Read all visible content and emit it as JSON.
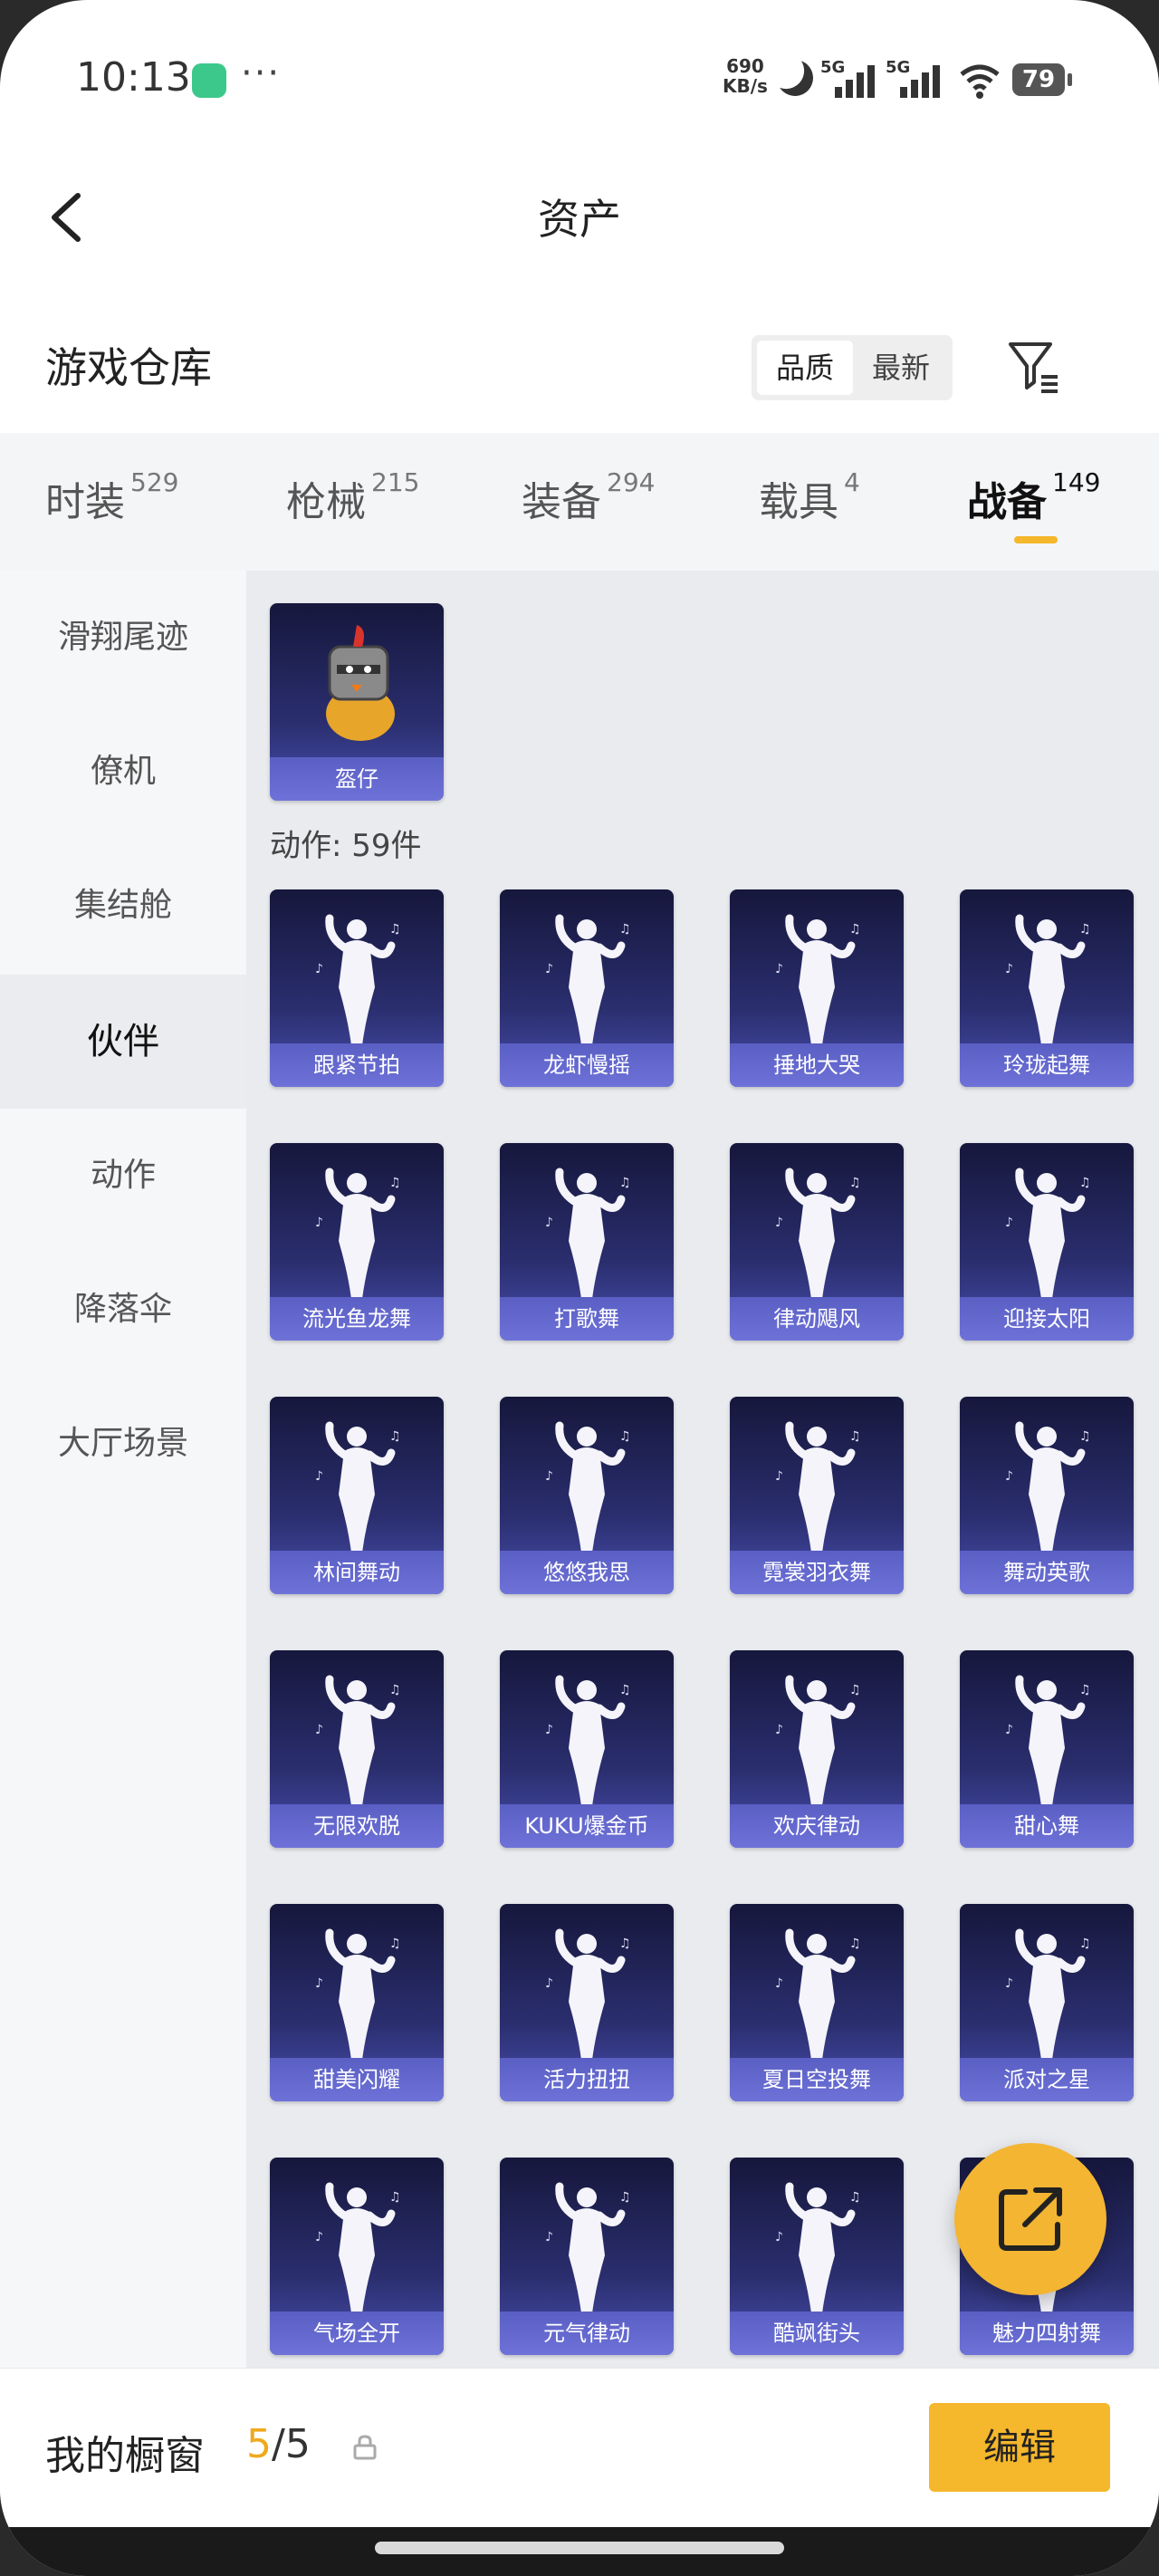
{
  "status": {
    "time": "10:13",
    "net_speed": "690",
    "net_unit": "KB/s",
    "sig1": "5G",
    "sig2": "5G",
    "battery": "79"
  },
  "header": {
    "title": "资产"
  },
  "warehouse": {
    "title": "游戏仓库",
    "sort_quality": "品质",
    "sort_newest": "最新"
  },
  "tabs": [
    {
      "label": "时装",
      "count": "529"
    },
    {
      "label": "枪械",
      "count": "215"
    },
    {
      "label": "装备",
      "count": "294"
    },
    {
      "label": "载具",
      "count": "4"
    },
    {
      "label": "战备",
      "count": "149"
    }
  ],
  "sidebar": [
    "滑翔尾迹",
    "僚机",
    "集结舱",
    "伙伴",
    "动作",
    "降落伞",
    "大厅场景"
  ],
  "partner": {
    "name": "盔仔"
  },
  "actions_count": "动作: 59件",
  "actions": [
    "跟紧节拍",
    "龙虾慢摇",
    "捶地大哭",
    "玲珑起舞",
    "流光鱼龙舞",
    "打歌舞",
    "律动飓风",
    "迎接太阳",
    "林间舞动",
    "悠悠我思",
    "霓裳羽衣舞",
    "舞动英歌",
    "无限欢脱",
    "KUKU爆金币",
    "欢庆律动",
    "甜心舞",
    "甜美闪耀",
    "活力扭扭",
    "夏日空投舞",
    "派对之星",
    "气场全开",
    "元气律动",
    "酷飒街头",
    "魅力四射舞"
  ],
  "showcase": {
    "label": "我的橱窗",
    "current": "5",
    "total": "/5",
    "edit": "编辑"
  }
}
